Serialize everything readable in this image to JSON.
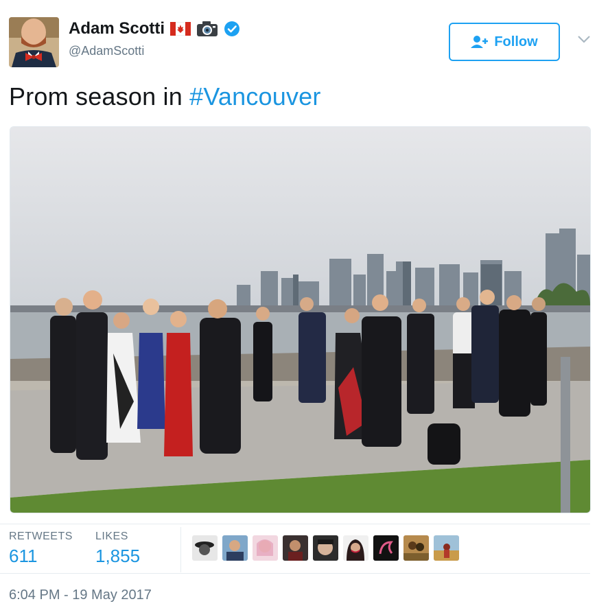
{
  "user": {
    "display_name": "Adam Scotti",
    "handle": "@AdamScotti",
    "avatar": "avatar-man-bowtie",
    "badges": [
      "canada-flag-icon",
      "camera-icon",
      "verified-icon"
    ]
  },
  "follow_button": {
    "label": "Follow",
    "icon": "add-user-icon"
  },
  "menu": {
    "icon": "chevron-down-icon"
  },
  "tweet": {
    "text": "Prom season in ",
    "hashtag": "#Vancouver"
  },
  "media": {
    "description_icon": "photo"
  },
  "stats": {
    "retweets_label": "RETWEETS",
    "retweets_value": "611",
    "likes_label": "LIKES",
    "likes_value": "1,855"
  },
  "likers_count_shown": 9,
  "timestamp": "6:04 PM - 19 May 2017",
  "colors": {
    "link": "#1b95e0",
    "follow": "#1da1f2",
    "muted": "#657786",
    "verified": "#1da1f2"
  }
}
